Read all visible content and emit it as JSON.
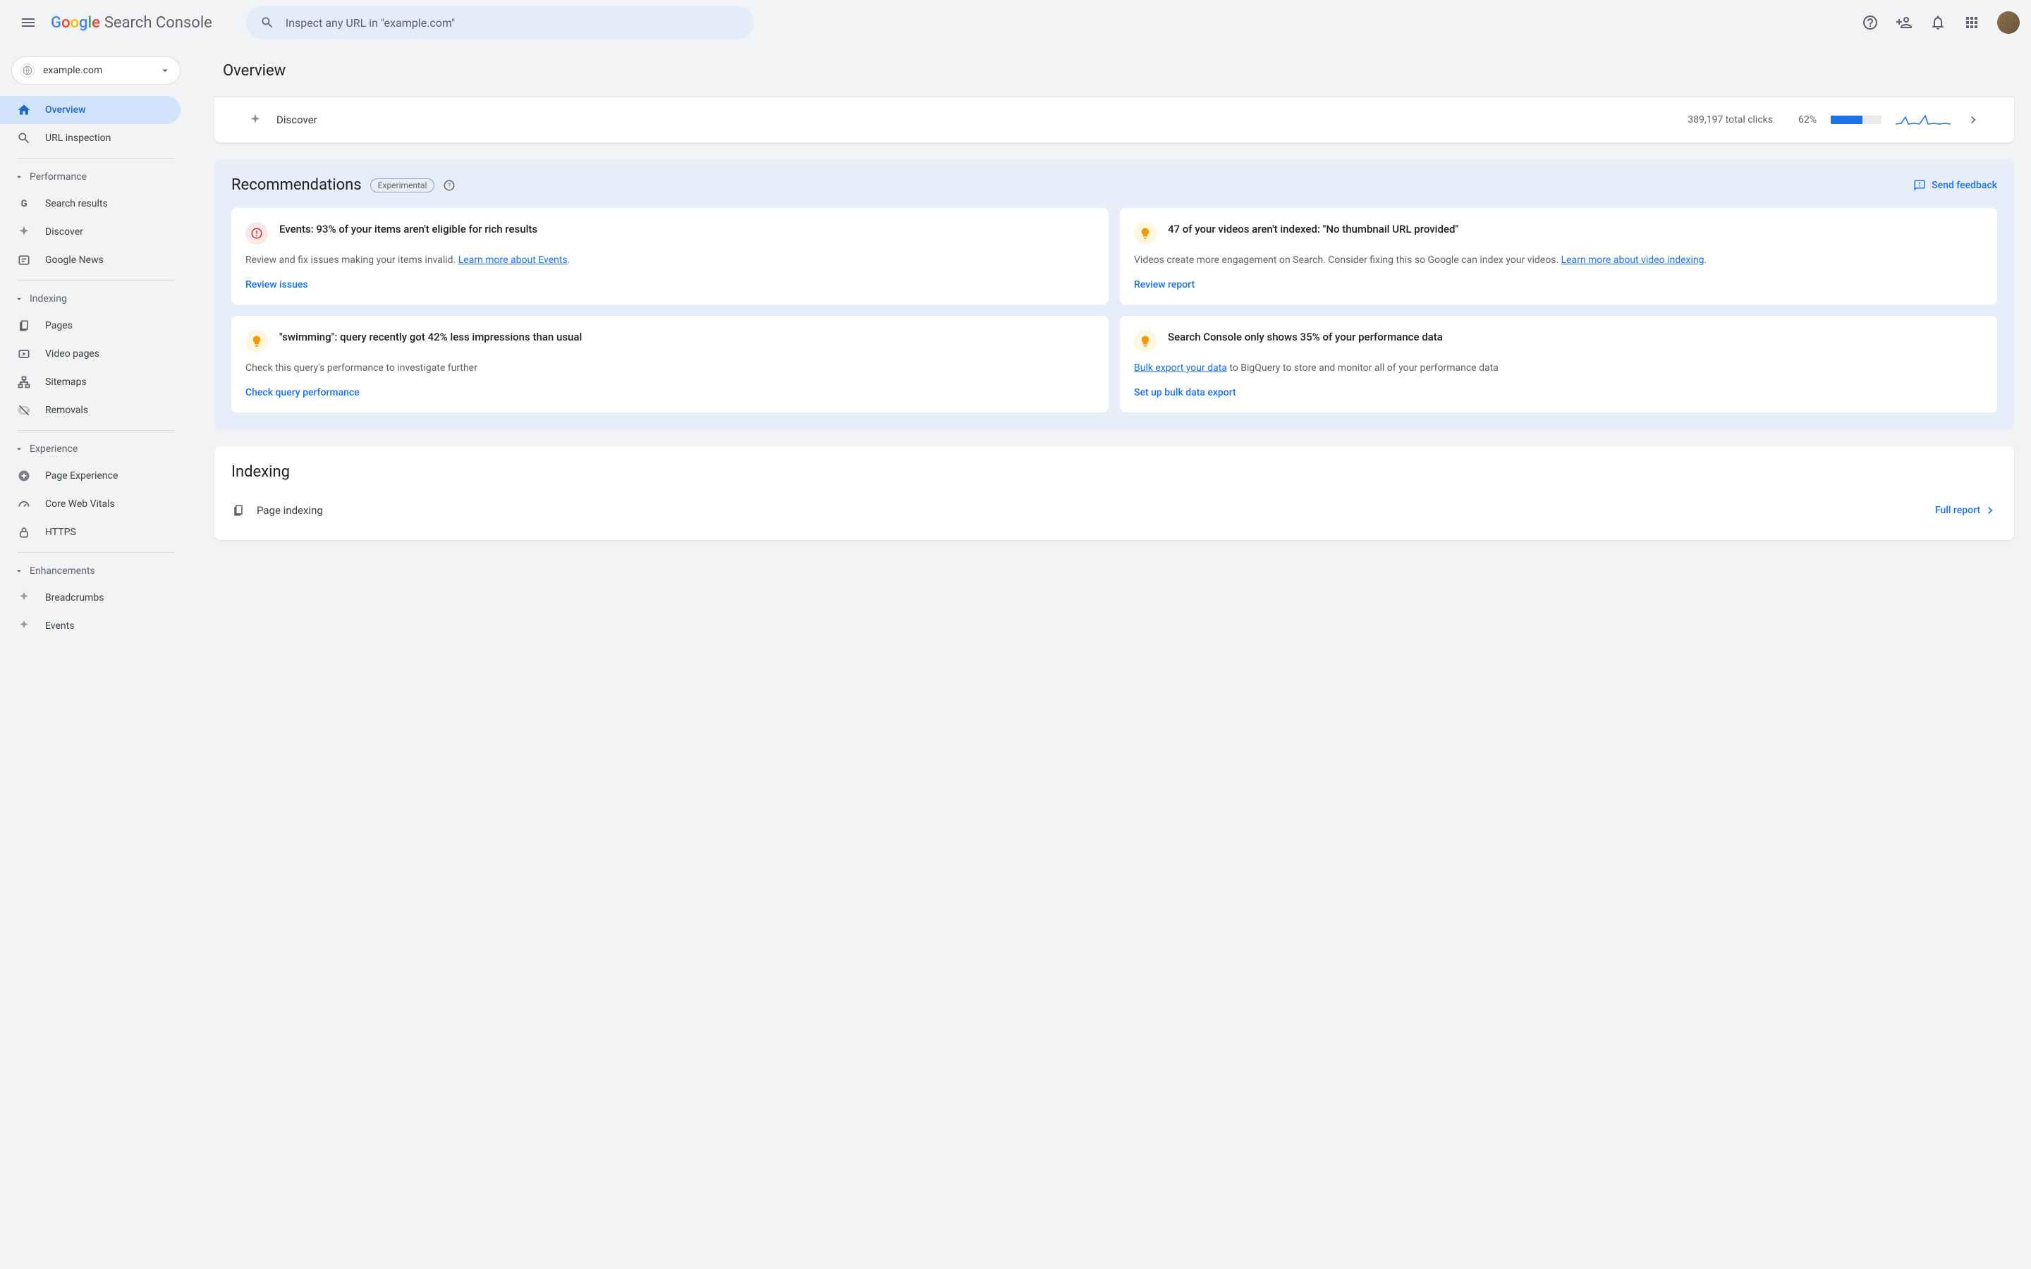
{
  "header": {
    "logo_text": "Search Console",
    "search_placeholder": "Inspect any URL in \"example.com\""
  },
  "property": {
    "name": "example.com"
  },
  "sidebar": {
    "overview": "Overview",
    "url_inspection": "URL inspection",
    "sections": {
      "performance": {
        "label": "Performance",
        "items": [
          "Search results",
          "Discover",
          "Google News"
        ]
      },
      "indexing": {
        "label": "Indexing",
        "items": [
          "Pages",
          "Video pages",
          "Sitemaps",
          "Removals"
        ]
      },
      "experience": {
        "label": "Experience",
        "items": [
          "Page Experience",
          "Core Web Vitals",
          "HTTPS"
        ]
      },
      "enhancements": {
        "label": "Enhancements",
        "items": [
          "Breadcrumbs",
          "Events"
        ]
      }
    }
  },
  "main": {
    "title": "Overview",
    "discover": {
      "label": "Discover",
      "clicks": "389,197 total clicks",
      "pct": "62%",
      "pct_value": 62
    },
    "recommendations": {
      "title": "Recommendations",
      "badge": "Experimental",
      "feedback": "Send feedback",
      "cards": [
        {
          "icon": "warn",
          "title": "Events: 93% of your items aren't eligible for rich results",
          "body_pre": "Review and fix issues making your items invalid. ",
          "link": "Learn more about Events",
          "body_post": ".",
          "action": "Review issues"
        },
        {
          "icon": "tip",
          "title": "47 of your videos aren't indexed: \"No thumbnail URL provided\"",
          "body_pre": "Videos create more engagement on Search. Consider fixing this so Google can index your videos. ",
          "link": "Learn more about video indexing",
          "body_post": ".",
          "action": "Review report"
        },
        {
          "icon": "tip",
          "title": "\"swimming\": query recently got 42% less impressions than usual",
          "body_pre": "Check this query's performance to investigate further",
          "link": "",
          "body_post": "",
          "action": "Check query performance"
        },
        {
          "icon": "tip",
          "title": "Search Console only shows 35% of your performance data",
          "body_pre": "",
          "link": "Bulk export your data",
          "body_post": " to BigQuery to store and monitor all of your performance data",
          "action": "Set up bulk data export"
        }
      ]
    },
    "indexing": {
      "title": "Indexing",
      "row_label": "Page indexing",
      "full_report": "Full report"
    }
  }
}
